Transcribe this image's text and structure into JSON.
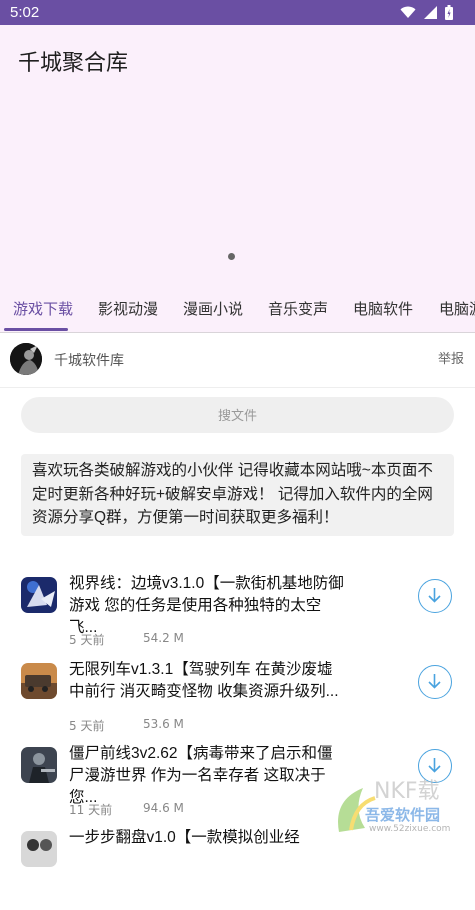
{
  "status_bar": {
    "time": "5:02"
  },
  "app": {
    "title": "千城聚合库"
  },
  "tabs": [
    {
      "label": "游戏下载",
      "active": true
    },
    {
      "label": "影视动漫"
    },
    {
      "label": "漫画小说"
    },
    {
      "label": "音乐变声"
    },
    {
      "label": "电脑软件"
    },
    {
      "label": "电脑游"
    }
  ],
  "source": {
    "name": "千城软件库",
    "report_label": "举报"
  },
  "search": {
    "placeholder": "搜文件"
  },
  "notice": "喜欢玩各类破解游戏的小伙伴 记得收藏本网站哦~本页面不定时更新各种好玩+破解安卓游戏！ 记得加入软件内的全网资源分享Q群，方便第一时间获取更多福利！",
  "items": [
    {
      "title": "视界线：边境v3.1.0【一款街机基地防御游戏 您的任务是使用各种独特的太空飞...",
      "time": "5 天前",
      "size": "54.2 M",
      "icon": "game-icon-space"
    },
    {
      "title": "无限列车v1.3.1【驾驶列车 在黄沙废墟中前行 消灭畸变怪物 收集资源升级列...",
      "time": "5 天前",
      "size": "53.6 M",
      "icon": "game-icon-train"
    },
    {
      "title": "僵尸前线3v2.62【病毒带来了启示和僵尸漫游世界 作为一名幸存者 这取决于您...",
      "time": "11 天前",
      "size": "94.6 M",
      "icon": "game-icon-zombie"
    },
    {
      "title": "一步步翻盘v1.0【一款模拟创业经",
      "time": "",
      "size": "",
      "icon": "game-icon-business"
    }
  ],
  "watermark": {
    "text": "吾爱软件园",
    "url_text": "www.52zixue.com"
  },
  "colors": {
    "status_bar": "#6a4fa3",
    "accent": "#6a4fa3",
    "header_bg": "#fbf0fb",
    "download": "#4aa3df"
  }
}
